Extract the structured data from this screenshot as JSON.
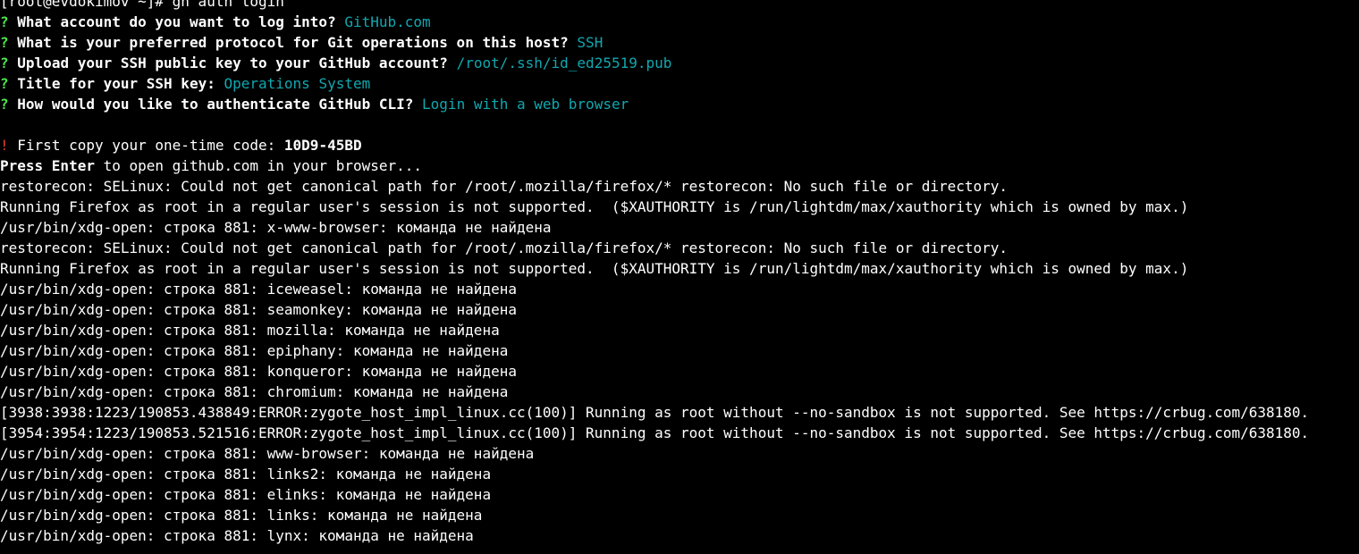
{
  "terminal": {
    "prompt_line": "[root@evdokimov ~]# gh auth login",
    "questions": [
      {
        "mark": "?",
        "question": "What account do you want to log into?",
        "answer": "GitHub.com"
      },
      {
        "mark": "?",
        "question": "What is your preferred protocol for Git operations on this host?",
        "answer": "SSH"
      },
      {
        "mark": "?",
        "question": "Upload your SSH public key to your GitHub account?",
        "answer": "/root/.ssh/id_ed25519.pub"
      },
      {
        "mark": "?",
        "question": "Title for your SSH key:",
        "answer": "Operations System"
      },
      {
        "mark": "?",
        "question": "How would you like to authenticate GitHub CLI?",
        "answer": "Login with a web browser"
      }
    ],
    "code_notice": {
      "mark": "!",
      "text": "First copy your one-time code:",
      "code": "10D9-45BD"
    },
    "press_enter": {
      "bold": "Press Enter",
      "rest": "to open github.com in your browser..."
    },
    "output_lines": [
      "restorecon: SELinux: Could not get canonical path for /root/.mozilla/firefox/* restorecon: No such file or directory.",
      "Running Firefox as root in a regular user's session is not supported.  ($XAUTHORITY is /run/lightdm/max/xauthority which is owned by max.)",
      "/usr/bin/xdg-open: строка 881: x-www-browser: команда не найдена",
      "restorecon: SELinux: Could not get canonical path for /root/.mozilla/firefox/* restorecon: No such file or directory.",
      "Running Firefox as root in a regular user's session is not supported.  ($XAUTHORITY is /run/lightdm/max/xauthority which is owned by max.)",
      "/usr/bin/xdg-open: строка 881: iceweasel: команда не найдена",
      "/usr/bin/xdg-open: строка 881: seamonkey: команда не найдена",
      "/usr/bin/xdg-open: строка 881: mozilla: команда не найдена",
      "/usr/bin/xdg-open: строка 881: epiphany: команда не найдена",
      "/usr/bin/xdg-open: строка 881: konqueror: команда не найдена",
      "/usr/bin/xdg-open: строка 881: chromium: команда не найдена",
      "[3938:3938:1223/190853.438849:ERROR:zygote_host_impl_linux.cc(100)] Running as root without --no-sandbox is not supported. See https://crbug.com/638180.",
      "[3954:3954:1223/190853.521516:ERROR:zygote_host_impl_linux.cc(100)] Running as root without --no-sandbox is not supported. See https://crbug.com/638180.",
      "/usr/bin/xdg-open: строка 881: www-browser: команда не найдена",
      "/usr/bin/xdg-open: строка 881: links2: команда не найдена",
      "/usr/bin/xdg-open: строка 881: elinks: команда не найдена",
      "/usr/bin/xdg-open: строка 881: links: команда не найдена",
      "/usr/bin/xdg-open: строка 881: lynx: команда не найдена"
    ],
    "colors": {
      "background": "#000000",
      "text": "#ffffff",
      "question_mark": "#4ee44e",
      "answer": "#11a8b0",
      "warning_mark": "#e03c31"
    }
  }
}
